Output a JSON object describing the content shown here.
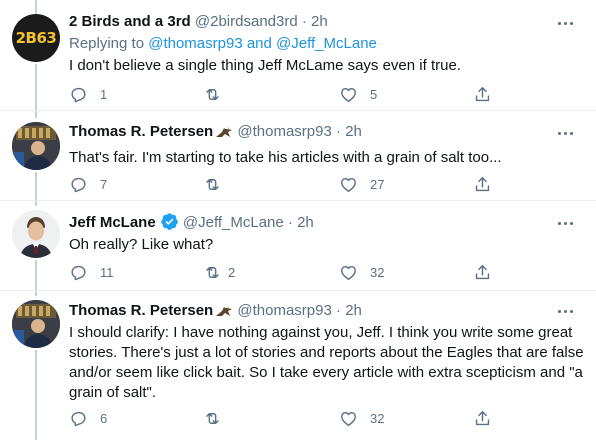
{
  "tweets": [
    {
      "name": "2 Birds and a 3rd",
      "handle": "@2birdsand3rd",
      "dot": "·",
      "time": "2h",
      "avatar_text": "2B63",
      "reply_prefix": "Replying to",
      "reply_user1": "@thomasrp93",
      "reply_and": "and",
      "reply_user2": "@Jeff_McLane",
      "text": "I don't believe a single thing Jeff McLame says even if true.",
      "replies": "1",
      "retweets": "",
      "likes": "5"
    },
    {
      "name": "Thomas R. Petersen",
      "handle": "@thomasrp93",
      "dot": "·",
      "time": "2h",
      "text": "That's fair. I'm starting to take his articles with a grain of salt too...",
      "replies": "7",
      "retweets": "",
      "likes": "27"
    },
    {
      "name": "Jeff McLane",
      "handle": "@Jeff_McLane",
      "dot": "·",
      "time": "2h",
      "text": "Oh really? Like what?",
      "replies": "11",
      "retweets": "2",
      "likes": "32"
    },
    {
      "name": "Thomas R. Petersen",
      "handle": "@thomasrp93",
      "dot": "·",
      "time": "2h",
      "text_lines": [
        "I should clarify: I have nothing against you, Jeff. I think you write some great",
        "stories. There's just a lot of stories and reports about the Eagles that are false",
        "and/or seem like click bait. So I take every article with extra scepticism and \"a",
        "grain of salt\"."
      ],
      "replies": "6",
      "retweets": "",
      "likes": "32"
    }
  ],
  "colors": {
    "text": "#0f1419",
    "secondary": "#5b7083",
    "link": "#1b95e0",
    "verified": "#1da1f2",
    "thread_line": "#c4cfd6"
  },
  "icons": [
    "reply-icon",
    "retweet-icon",
    "like-icon",
    "share-icon",
    "more-icon",
    "verified-badge-icon",
    "eagle-emoji-icon"
  ]
}
